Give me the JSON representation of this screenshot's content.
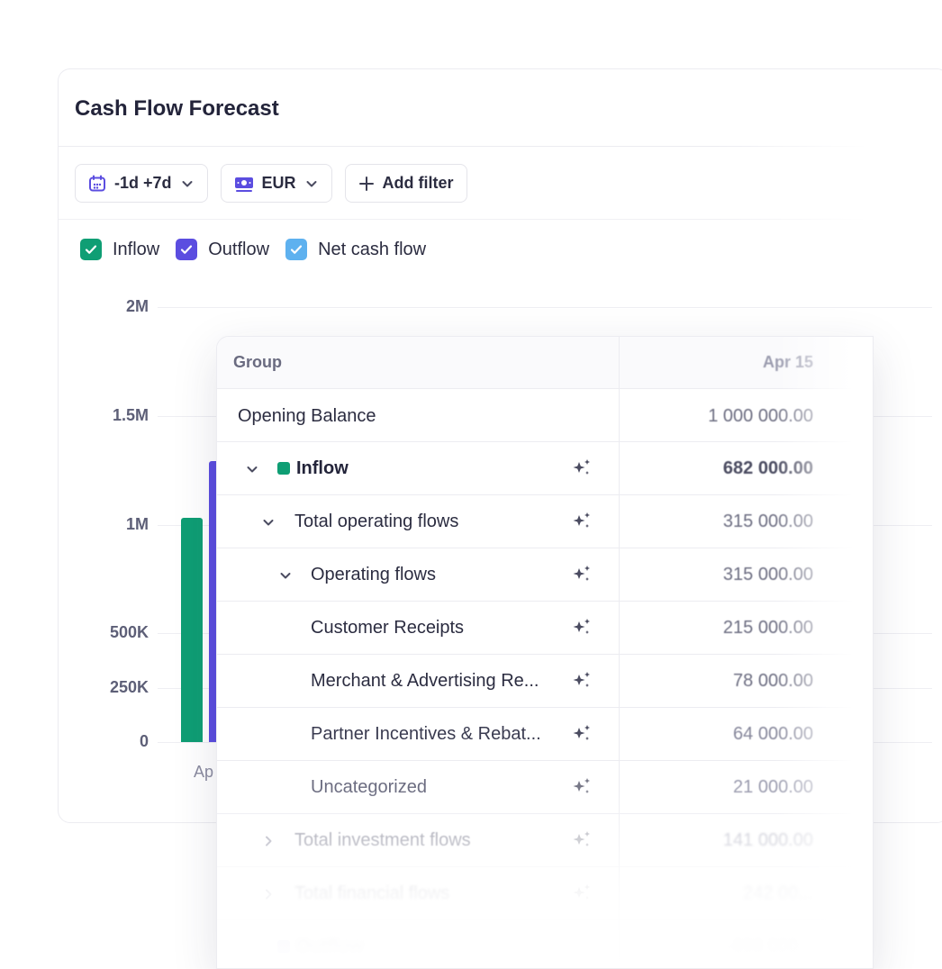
{
  "card": {
    "title": "Cash Flow Forecast",
    "toolbar": {
      "date_range_label": "-1d +7d",
      "currency_label": "EUR",
      "add_filter_label": "Add filter"
    },
    "legend": [
      {
        "label": "Inflow",
        "color": "#0f9e74",
        "checked": true
      },
      {
        "label": "Outflow",
        "color": "#5b4de0",
        "checked": true
      },
      {
        "label": "Net cash flow",
        "color": "#5eb1ef",
        "checked": true
      }
    ]
  },
  "chart_data": {
    "type": "bar",
    "categories": [
      "Ap"
    ],
    "series": [
      {
        "name": "Inflow",
        "color": "#0f9e74",
        "values": [
          1030000
        ]
      },
      {
        "name": "Outflow",
        "color": "#5b4de0",
        "values": [
          1290000
        ]
      }
    ],
    "yticks": [
      "0",
      "250K",
      "500K",
      "1M",
      "1.5M",
      "2M"
    ],
    "ylim": [
      0,
      2000000
    ],
    "grid": true
  },
  "table": {
    "header": {
      "group": "Group",
      "date": "Apr 15"
    },
    "rows": [
      {
        "label": "Opening Balance",
        "value": "1 000 000.00"
      },
      {
        "label": "Inflow",
        "value": "682 000.00"
      },
      {
        "label": "Total operating flows",
        "value": "315 000.00"
      },
      {
        "label": "Operating flows",
        "value": "315 000.00"
      },
      {
        "label": "Customer Receipts",
        "value": "215 000.00"
      },
      {
        "label": "Merchant & Advertising Re...",
        "value": "78 000.00"
      },
      {
        "label": "Partner Incentives & Rebat...",
        "value": "64 000.00"
      },
      {
        "label": "Uncategorized",
        "value": "21 000.00"
      },
      {
        "label": "Total investment flows",
        "value": "141 000.00"
      },
      {
        "label": "Total financial flows",
        "value": "242 00..."
      },
      {
        "label": "Outflow",
        "value": "-698 000..."
      }
    ]
  }
}
